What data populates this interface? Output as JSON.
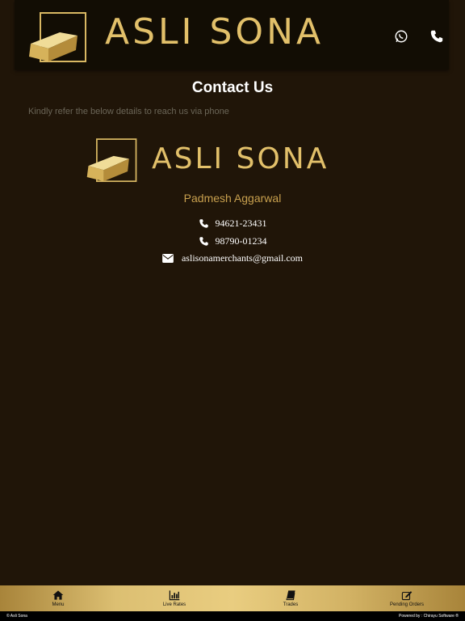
{
  "header": {
    "brand": "ASLI SONA",
    "whatsapp_icon": "whatsapp-icon",
    "phone_icon": "phone-icon"
  },
  "page": {
    "title": "Contact Us",
    "subtitle": "Kindly refer the below details to reach us via phone"
  },
  "contact": {
    "brand": "ASLI SONA",
    "name": "Padmesh Aggarwal",
    "phones": [
      "94621-23431",
      "98790-01234"
    ],
    "email": "aslisonamerchants@gmail.com"
  },
  "tabs": [
    {
      "label": "Menu",
      "icon": "home-icon"
    },
    {
      "label": "Live Rates",
      "icon": "bar-chart-icon"
    },
    {
      "label": "Trades",
      "icon": "book-icon"
    },
    {
      "label": "Pending Orders",
      "icon": "edit-icon"
    }
  ],
  "footer": {
    "left": "© Asli Sona",
    "right": "Powered by : Chirayu Software ®"
  },
  "colors": {
    "background": "#201508",
    "gold": "#e2c06a",
    "header": "#120d04"
  }
}
